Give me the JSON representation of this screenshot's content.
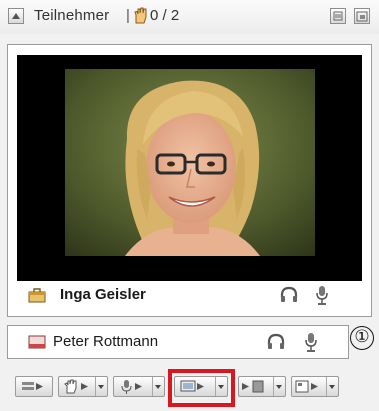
{
  "title": "Teilnehmer",
  "title_separator": "|",
  "participant_count": "0 / 2",
  "participants": [
    {
      "name": "Inga Geisler"
    },
    {
      "name": "Peter Rottmann"
    }
  ],
  "annotation_marker": "①",
  "colors": {
    "highlight": "#d7191f",
    "video_background": "#000000"
  }
}
